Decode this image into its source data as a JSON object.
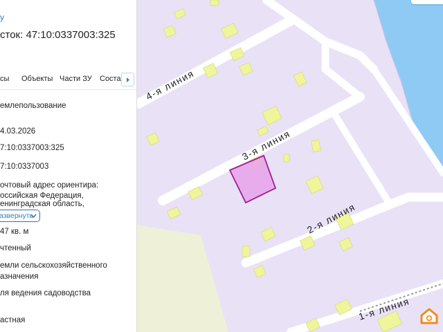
{
  "panel": {
    "top_link": "у",
    "title": "сток: 47:10:0337003:325",
    "tabs": [
      {
        "label": "сы"
      },
      {
        "label": "Объекты"
      },
      {
        "label": "Части ЗУ"
      },
      {
        "label": "Состав"
      }
    ],
    "fields": [
      {
        "lines": [
          "емлепользование"
        ]
      },
      {
        "lines": [
          "4.03.2026"
        ]
      },
      {
        "lines": [
          "7:10:0337003:325"
        ]
      },
      {
        "lines": [
          "7:10:0337003"
        ]
      },
      {
        "lines": [
          "очтовый адрес ориентира:",
          "оссийская Федерация,",
          "енинградская область,"
        ]
      },
      {
        "lines": [
          "47 кв. м"
        ]
      },
      {
        "lines": [
          "чтенный"
        ]
      },
      {
        "lines": [
          "емли сельскохозяйственного",
          "азначения"
        ]
      },
      {
        "lines": [
          "ля ведения садоводства"
        ]
      },
      {
        "lines": [
          "астная"
        ]
      }
    ],
    "expand_label": "азвернуть"
  },
  "map": {
    "streets": [
      "4-я линия",
      "3-я линия",
      "2-я линия",
      "1-я линия"
    ],
    "colors": {
      "background": "#e9e1f6",
      "water": "#8fcaf4",
      "field": "#eef0d8",
      "road": "#ffffff",
      "building": "#eef59a",
      "parcel_fill": "#e8a2ea",
      "parcel_stroke": "#9c1f93"
    }
  },
  "icons": {
    "tab_next": "chevron-right-icon",
    "expand": "chevron-down-icon",
    "logo": "house-logo-icon"
  }
}
